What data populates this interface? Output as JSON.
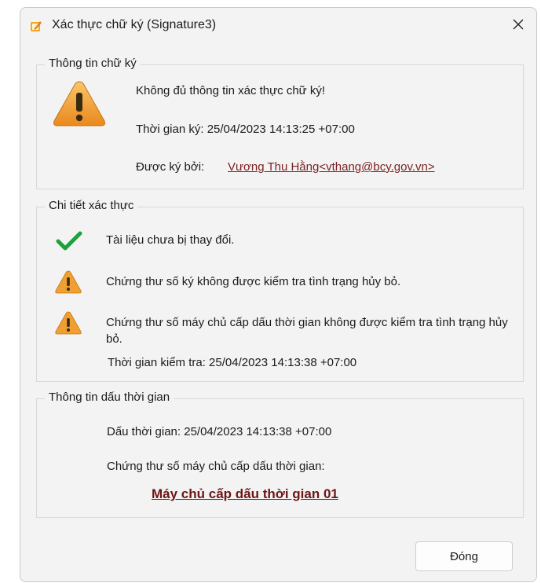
{
  "window": {
    "title": "Xác thực chữ ký (Signature3)",
    "app_icon": "signature-document-icon",
    "close_icon": "close-icon"
  },
  "signature_info": {
    "title": "Thông tin chữ ký",
    "status_icon": "warning-icon",
    "message": "Không đủ thông tin xác thực chữ ký!",
    "signing_time": "Thời gian ký: 25/04/2023 14:13:25 +07:00",
    "signed_by_label": "Được ký bởi:",
    "signer": "Vương Thu Hằng<vthang@bcy.gov.vn>"
  },
  "validation_details": {
    "title": "Chi tiết xác thực",
    "items": [
      {
        "icon": "checkmark-icon",
        "text": "Tài liệu chưa bị thay đổi."
      },
      {
        "icon": "warning-icon",
        "text": "Chứng thư số ký không được kiểm tra tình trạng hủy bỏ."
      },
      {
        "icon": "warning-icon",
        "text": "Chứng thư số máy chủ cấp dấu thời gian không được kiểm tra tình trạng hủy bỏ."
      }
    ],
    "check_time": "Thời gian kiểm tra: 25/04/2023 14:13:38 +07:00"
  },
  "timestamp_info": {
    "title": "Thông tin dấu thời gian",
    "timestamp": "Dấu thời gian: 25/04/2023 14:13:38 +07:00",
    "tsa_cert_label": "Chứng thư số máy chủ cấp dấu thời gian:",
    "tsa_link": "Máy chủ cấp dấu thời gian 01"
  },
  "buttons": {
    "close_label": "Đóng"
  },
  "colors": {
    "dialog_bg": "#f3f3f3",
    "warning": "#f0a030",
    "check": "#1aa33a",
    "link": "#7a1f1f"
  }
}
